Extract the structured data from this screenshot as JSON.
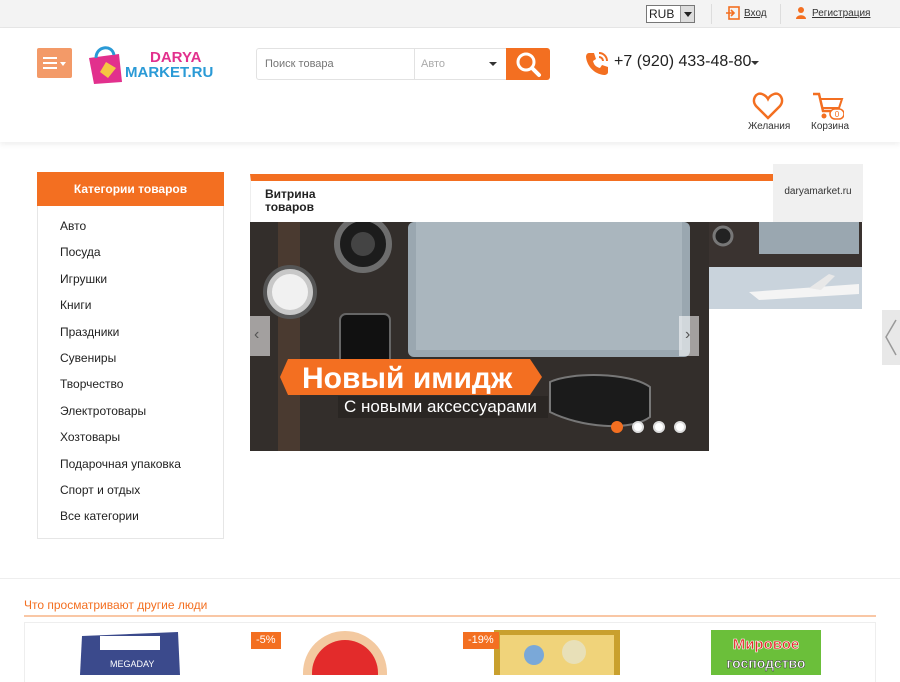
{
  "topbar": {
    "currency": "RUB",
    "login_label": "Вход",
    "register_label": "Регистрация"
  },
  "header": {
    "logo_line1": "DARYA",
    "logo_line2": "MARKET.RU",
    "search_placeholder": "Поиск товара",
    "search_category": "Авто",
    "phone": "+7 (920) 433-48-80",
    "wishlist_label": "Желания",
    "cart_label": "Корзина",
    "cart_count": "0"
  },
  "categories": {
    "title": "Категории товаров",
    "items": [
      {
        "label": "Авто"
      },
      {
        "label": "Посуда"
      },
      {
        "label": "Игрушки"
      },
      {
        "label": "Книги"
      },
      {
        "label": "Праздники"
      },
      {
        "label": "Сувениры"
      },
      {
        "label": "Творчество"
      },
      {
        "label": "Электротовары"
      },
      {
        "label": "Хозтовары"
      },
      {
        "label": "Подарочная упаковка"
      },
      {
        "label": "Спорт и отдых"
      },
      {
        "label": "Все категории"
      }
    ]
  },
  "showcase": {
    "title": "Витрина товаров",
    "site_tab": "daryamarket.ru",
    "slide_headline": "Новый имидж",
    "slide_subline": "С новыми аксессуарами",
    "dots_total": 4,
    "dots_active": 1
  },
  "popular": {
    "title": "Что просматривают другие люди",
    "products": [
      {
        "badge": "",
        "brand": "MEGADAY"
      },
      {
        "badge": "-5%"
      },
      {
        "badge": "-19%"
      },
      {
        "badge": "",
        "line1": "Мировое",
        "line2": "господство"
      }
    ]
  },
  "colors": {
    "accent": "#f36f21",
    "menu_button": "#f39a68",
    "logo_pink": "#e2308d",
    "logo_blue": "#2a9ad6"
  }
}
